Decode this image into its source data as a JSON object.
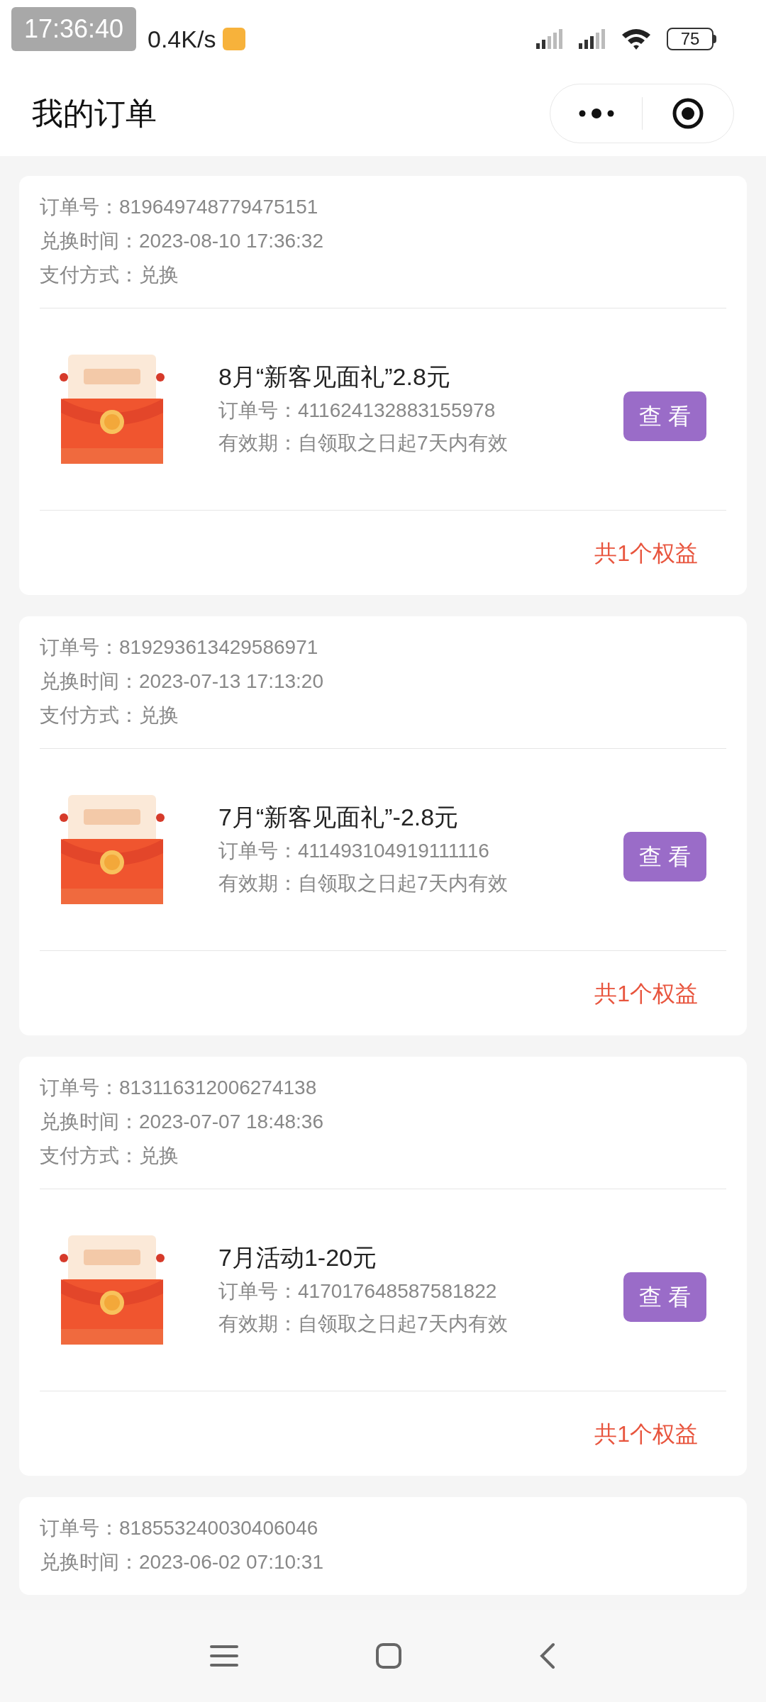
{
  "status_bar": {
    "clock_overlay": "17:36:40",
    "time_speed": "0.4K/s",
    "battery": "75"
  },
  "header": {
    "title": "我的订单"
  },
  "orders": [
    {
      "order_no_label": "订单号：",
      "order_no": "819649748779475151",
      "time_label": "兑换时间：",
      "time": "2023-08-10 17:36:32",
      "pay_label": "支付方式：",
      "pay": "兑换",
      "item": {
        "kind": "picture",
        "title": "8月“新客见面礼”2.8元",
        "code_label": "订单号：",
        "code": "411624132883155978",
        "validity_label": "有效期：",
        "validity": "自领取之日起7天内有效",
        "button": "查 看"
      },
      "total": "共1个权益"
    },
    {
      "order_no_label": "订单号：",
      "order_no": "819293613429586971",
      "time_label": "兑换时间：",
      "time": "2023-07-13 17:13:20",
      "pay_label": "支付方式：",
      "pay": "兑换",
      "item": {
        "kind": "picture",
        "title": "7月“新客见面礼”-2.8元",
        "code_label": "订单号：",
        "code": "411493104919111116",
        "validity_label": "有效期：",
        "validity": "自领取之日起7天内有效",
        "button": "查 看"
      },
      "total": "共1个权益"
    },
    {
      "order_no_label": "订单号：",
      "order_no": "813116312006274138",
      "time_label": "兑换时间：",
      "time": "2023-07-07 18:48:36",
      "pay_label": "支付方式：",
      "pay": "兑换",
      "item": {
        "kind": "picture",
        "title": "7月活动1-20元",
        "code_label": "订单号：",
        "code": "417017648587581822",
        "validity_label": "有效期：",
        "validity": "自领取之日起7天内有效",
        "button": "查 看"
      },
      "total": "共1个权益"
    },
    {
      "order_no_label": "订单号：",
      "order_no": "818553240030406046",
      "time_label": "兑换时间：",
      "time": "2023-06-02 07:10:31"
    }
  ]
}
